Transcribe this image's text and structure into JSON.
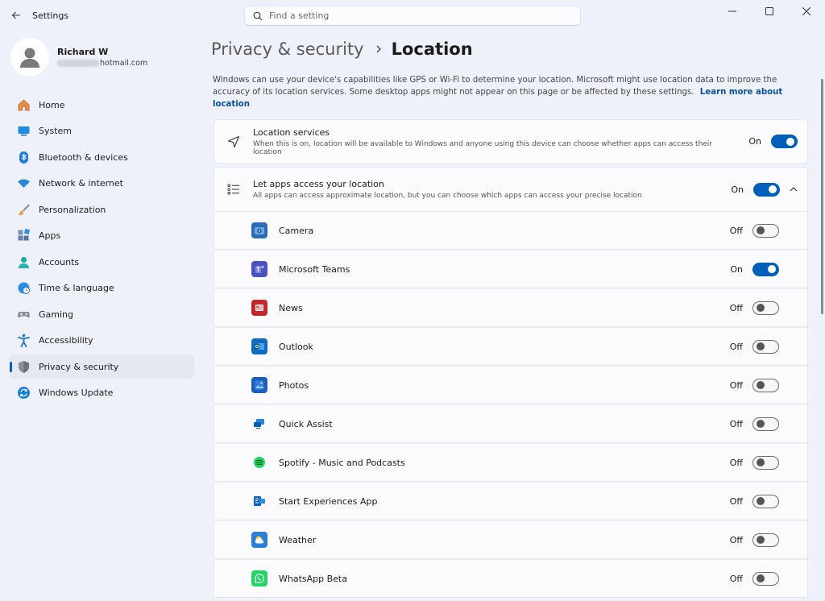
{
  "window": {
    "title": "Settings"
  },
  "search": {
    "placeholder": "Find a setting"
  },
  "profile": {
    "name": "Richard W",
    "email_domain": "hotmail.com"
  },
  "sidebar": {
    "items": [
      {
        "label": "Home",
        "icon": "home-icon"
      },
      {
        "label": "System",
        "icon": "system-icon"
      },
      {
        "label": "Bluetooth & devices",
        "icon": "bluetooth-icon"
      },
      {
        "label": "Network & internet",
        "icon": "network-icon"
      },
      {
        "label": "Personalization",
        "icon": "brush-icon"
      },
      {
        "label": "Apps",
        "icon": "apps-icon"
      },
      {
        "label": "Accounts",
        "icon": "accounts-icon"
      },
      {
        "label": "Time & language",
        "icon": "globe-clock-icon"
      },
      {
        "label": "Gaming",
        "icon": "gamepad-icon"
      },
      {
        "label": "Accessibility",
        "icon": "accessibility-icon"
      },
      {
        "label": "Privacy & security",
        "icon": "shield-icon",
        "active": true
      },
      {
        "label": "Windows Update",
        "icon": "update-icon"
      }
    ]
  },
  "breadcrumb": {
    "parent": "Privacy & security",
    "current": "Location"
  },
  "description": {
    "text": "Windows can use your device's capabilities like GPS or Wi-Fi to determine your location. Microsoft might use location data to improve the accuracy of its location services. Some desktop apps might not appear on this page or be affected by these settings.",
    "link": "Learn more about location"
  },
  "location_services": {
    "title": "Location services",
    "subtitle": "When this is on, location will be available to Windows and anyone using this device can choose whether apps can access their location",
    "state": "On"
  },
  "let_apps": {
    "title": "Let apps access your location",
    "subtitle": "All apps can access approximate location, but you can choose which apps can access your precise location",
    "state": "On"
  },
  "apps": [
    {
      "name": "Camera",
      "state": "Off",
      "color": "#2b6cb3"
    },
    {
      "name": "Microsoft Teams",
      "state": "On",
      "color": "#4b53bc"
    },
    {
      "name": "News",
      "state": "Off",
      "color": "#c4262e"
    },
    {
      "name": "Outlook",
      "state": "Off",
      "color": "#0f6cbd"
    },
    {
      "name": "Photos",
      "state": "Off",
      "color": "#1d5fb8"
    },
    {
      "name": "Quick Assist",
      "state": "Off",
      "color": "#0a74d6"
    },
    {
      "name": "Spotify - Music and Podcasts",
      "state": "Off",
      "color": "#1ed760"
    },
    {
      "name": "Start Experiences App",
      "state": "Off",
      "color": "#0e5fb5"
    },
    {
      "name": "Weather",
      "state": "Off",
      "color": "#f3a81c"
    },
    {
      "name": "WhatsApp Beta",
      "state": "Off",
      "color": "#25d366"
    }
  ],
  "colors": {
    "accent": "#005fb8",
    "background": "#eef1f9",
    "card": "#fbfbfd"
  }
}
